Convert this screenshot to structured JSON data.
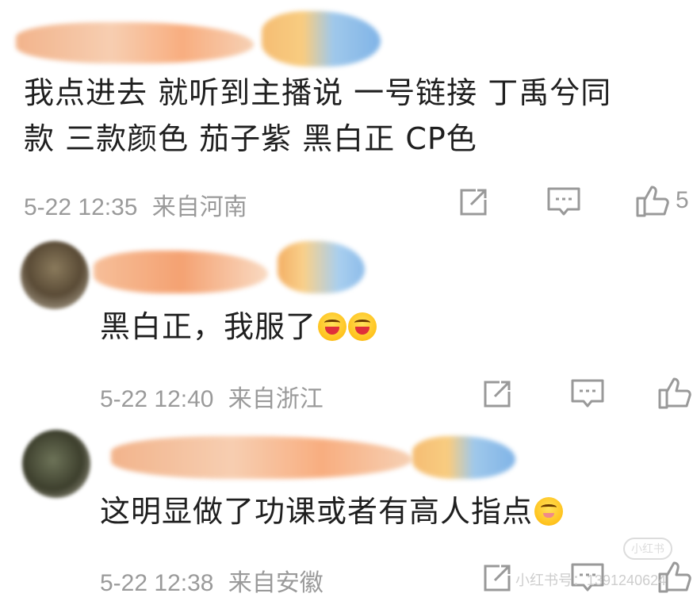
{
  "comments": [
    {
      "text_line1": "我点进去 就听到主播说 一号链接 丁禹兮同",
      "text_line2": "款 三款颜色 茄子紫  黑白正 CP色",
      "time": "5-22 12:35",
      "location": "来自河南",
      "like_count": "5"
    },
    {
      "text": "黑白正，我服了",
      "emoji": [
        "laugh-emoji",
        "laugh-emoji"
      ],
      "time": "5-22 12:40",
      "location": "来自浙江"
    },
    {
      "text": "这明显做了功课或者有高人指点",
      "emoji": [
        "shy-emoji"
      ],
      "time": "5-22 12:38",
      "location": "来自安徽"
    }
  ],
  "watermark": {
    "badge": "小红书",
    "text": "小红书号：1391240624"
  },
  "icons": [
    "share-icon",
    "comment-icon",
    "like-icon"
  ]
}
